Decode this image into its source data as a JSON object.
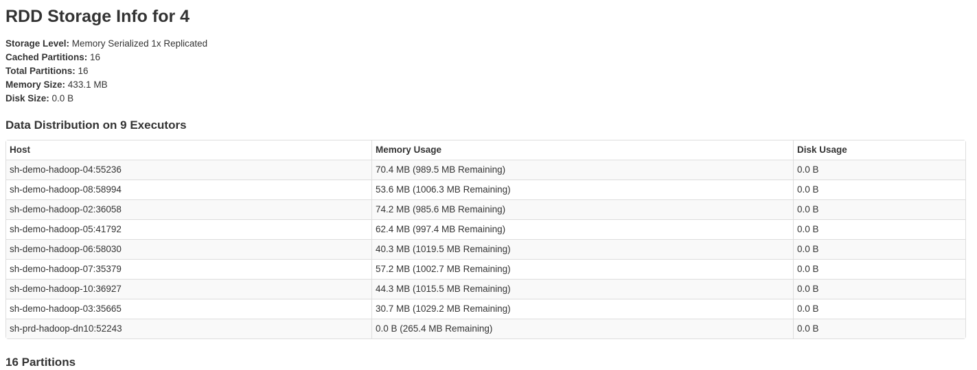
{
  "page": {
    "title": "RDD Storage Info for 4"
  },
  "summary": [
    {
      "label": "Storage Level:",
      "value": "Memory Serialized 1x Replicated"
    },
    {
      "label": "Cached Partitions:",
      "value": "16"
    },
    {
      "label": "Total Partitions:",
      "value": "16"
    },
    {
      "label": "Memory Size:",
      "value": "433.1 MB"
    },
    {
      "label": "Disk Size:",
      "value": "0.0 B"
    }
  ],
  "distribution": {
    "title": "Data Distribution on 9 Executors",
    "columns": [
      "Host",
      "Memory Usage",
      "Disk Usage"
    ],
    "rows": [
      [
        "sh-demo-hadoop-04:55236",
        "70.4 MB (989.5 MB Remaining)",
        "0.0 B"
      ],
      [
        "sh-demo-hadoop-08:58994",
        "53.6 MB (1006.3 MB Remaining)",
        "0.0 B"
      ],
      [
        "sh-demo-hadoop-02:36058",
        "74.2 MB (985.6 MB Remaining)",
        "0.0 B"
      ],
      [
        "sh-demo-hadoop-05:41792",
        "62.4 MB (997.4 MB Remaining)",
        "0.0 B"
      ],
      [
        "sh-demo-hadoop-06:58030",
        "40.3 MB (1019.5 MB Remaining)",
        "0.0 B"
      ],
      [
        "sh-demo-hadoop-07:35379",
        "57.2 MB (1002.7 MB Remaining)",
        "0.0 B"
      ],
      [
        "sh-demo-hadoop-10:36927",
        "44.3 MB (1015.5 MB Remaining)",
        "0.0 B"
      ],
      [
        "sh-demo-hadoop-03:35665",
        "30.7 MB (1029.2 MB Remaining)",
        "0.0 B"
      ],
      [
        "sh-prd-hadoop-dn10:52243",
        "0.0 B (265.4 MB Remaining)",
        "0.0 B"
      ]
    ]
  },
  "partitions": {
    "title": "16 Partitions"
  }
}
